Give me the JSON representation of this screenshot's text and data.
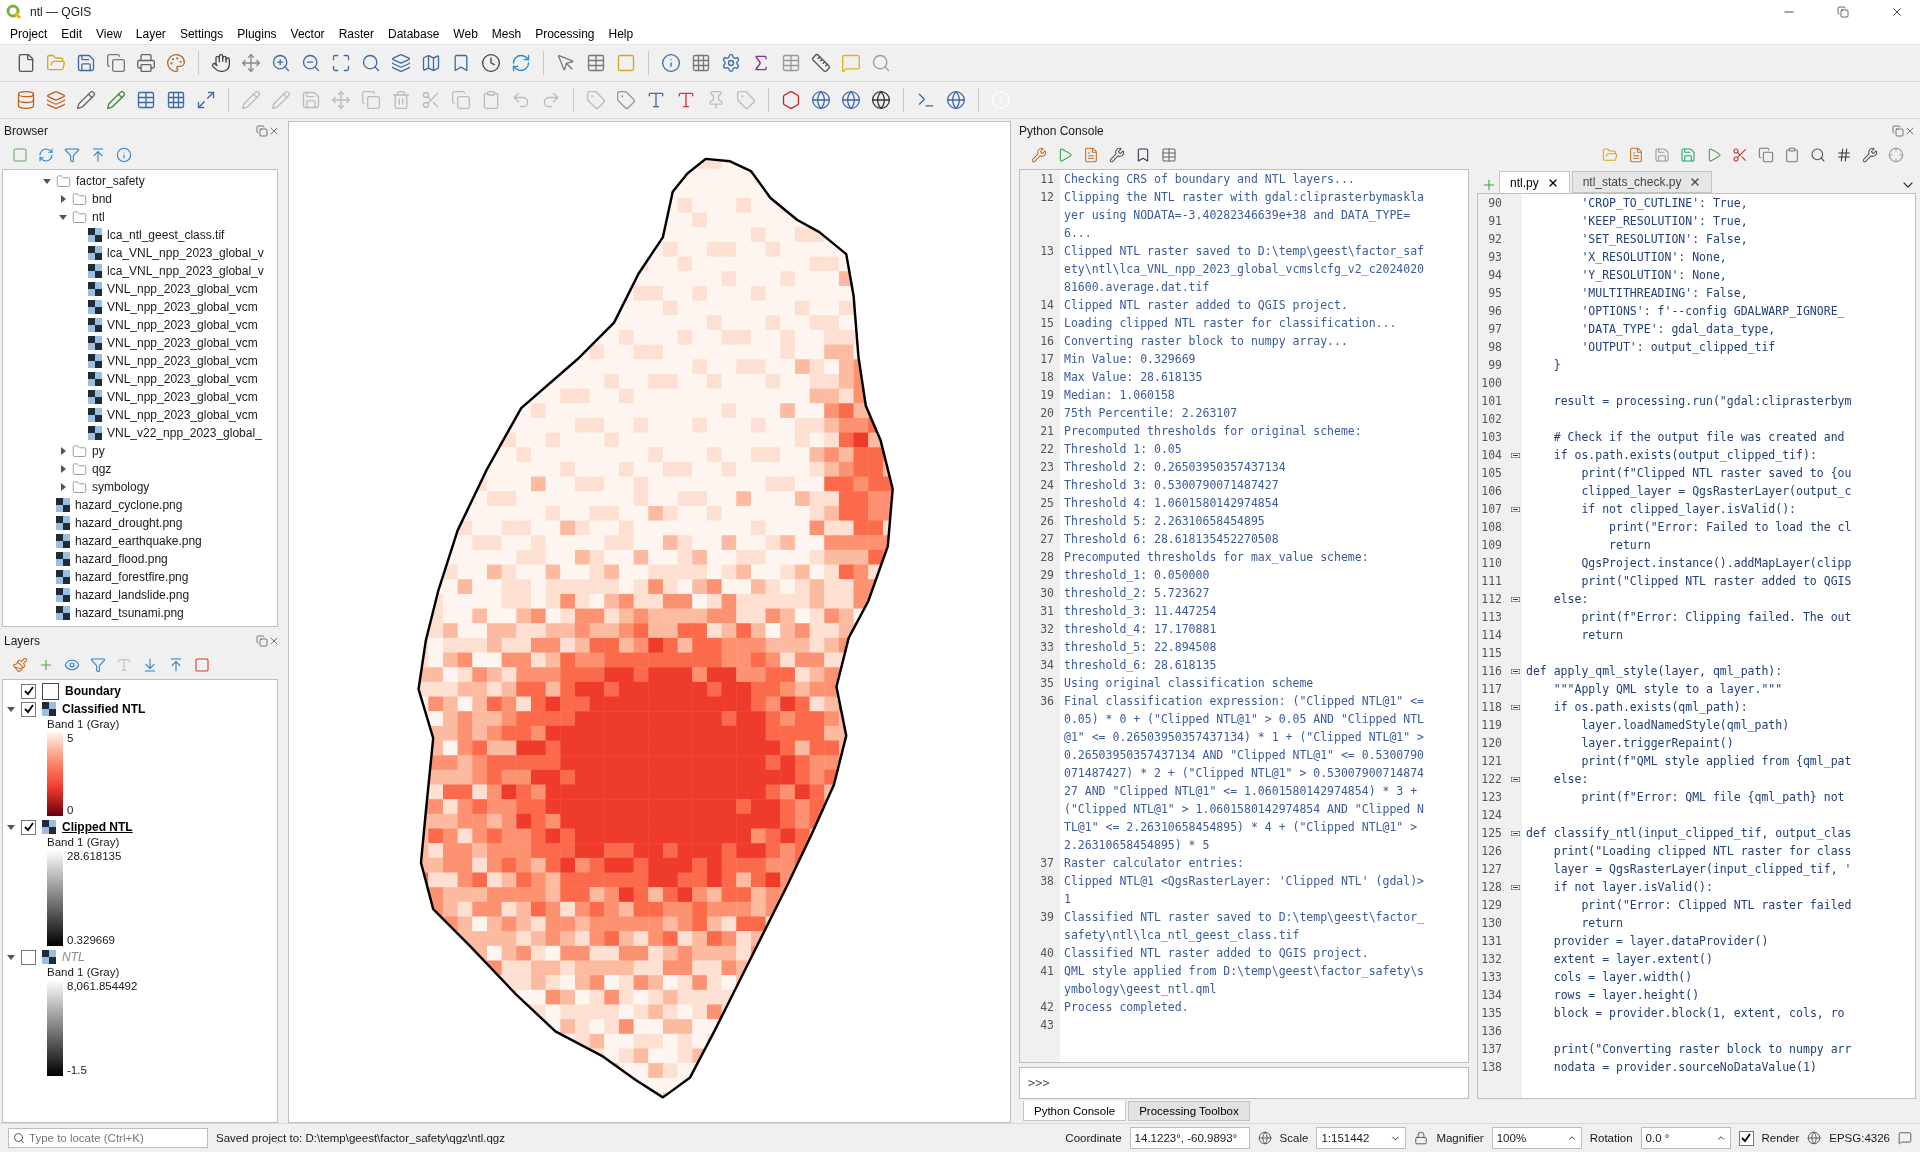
{
  "window": {
    "title": "ntl — QGIS"
  },
  "menu": [
    "Project",
    "Edit",
    "View",
    "Layer",
    "Settings",
    "Plugins",
    "Vector",
    "Raster",
    "Database",
    "Web",
    "Mesh",
    "Processing",
    "Help"
  ],
  "browser": {
    "title": "Browser",
    "items": [
      {
        "label": "factor_safety",
        "kind": "folder",
        "expanded": true,
        "children": [
          {
            "label": "bnd",
            "kind": "folder",
            "expanded": false
          },
          {
            "label": "ntl",
            "kind": "folder",
            "expanded": true,
            "children": [
              {
                "label": "lca_ntl_geest_class.tif",
                "kind": "raster"
              },
              {
                "label": "lca_VNL_npp_2023_global_v",
                "kind": "raster"
              },
              {
                "label": "lca_VNL_npp_2023_global_v",
                "kind": "raster"
              },
              {
                "label": "VNL_npp_2023_global_vcm",
                "kind": "raster"
              },
              {
                "label": "VNL_npp_2023_global_vcm",
                "kind": "raster"
              },
              {
                "label": "VNL_npp_2023_global_vcm",
                "kind": "raster"
              },
              {
                "label": "VNL_npp_2023_global_vcm",
                "kind": "raster"
              },
              {
                "label": "VNL_npp_2023_global_vcm",
                "kind": "raster"
              },
              {
                "label": "VNL_npp_2023_global_vcm",
                "kind": "raster"
              },
              {
                "label": "VNL_npp_2023_global_vcm",
                "kind": "raster"
              },
              {
                "label": "VNL_npp_2023_global_vcm",
                "kind": "raster"
              },
              {
                "label": "VNL_v22_npp_2023_global_",
                "kind": "raster"
              }
            ]
          },
          {
            "label": "py",
            "kind": "folder",
            "expanded": false
          },
          {
            "label": "qgz",
            "kind": "folder",
            "expanded": false
          },
          {
            "label": "symbology",
            "kind": "folder",
            "expanded": false
          }
        ]
      },
      {
        "label": "hazard_cyclone.png",
        "kind": "raster"
      },
      {
        "label": "hazard_drought.png",
        "kind": "raster"
      },
      {
        "label": "hazard_earthquake.png",
        "kind": "raster"
      },
      {
        "label": "hazard_flood.png",
        "kind": "raster"
      },
      {
        "label": "hazard_forestfire.png",
        "kind": "raster"
      },
      {
        "label": "hazard_landslide.png",
        "kind": "raster"
      },
      {
        "label": "hazard_tsunami.png",
        "kind": "raster"
      }
    ]
  },
  "layers": {
    "title": "Layers",
    "items": [
      {
        "name": "Boundary",
        "kind": "vector",
        "checked": true,
        "selected": false
      },
      {
        "name": "Classified NTL",
        "kind": "pseudocolor",
        "checked": true,
        "selected": false,
        "expanded": true,
        "band": "Band 1 (Gray)",
        "max": "5",
        "min": "0"
      },
      {
        "name": "Clipped NTL",
        "kind": "gray",
        "checked": true,
        "selected": true,
        "expanded": true,
        "band": "Band 1 (Gray)",
        "max": "28.618135",
        "min": "0.329669"
      },
      {
        "name": "NTL",
        "kind": "gray",
        "checked": false,
        "selected": false,
        "expanded": true,
        "band": "Band 1 (Gray)",
        "max": "8,061.854492",
        "min": "-1.5"
      }
    ]
  },
  "python_console": {
    "title": "Python Console",
    "output": [
      {
        "n": "11",
        "text": "Checking CRS of boundary and NTL layers..."
      },
      {
        "n": "12",
        "text": "Clipping the NTL raster with gdal:cliprasterbymasklayer using NODATA=-3.40282346639e+38 and DATA_TYPE=6..."
      },
      {
        "n": "13",
        "text": "Clipped NTL raster saved to D:\\temp\\geest\\factor_safety\\ntl\\lca_VNL_npp_2023_global_vcmslcfg_v2_c202402081600.average.dat.tif"
      },
      {
        "n": "14",
        "text": "Clipped NTL raster added to QGIS project."
      },
      {
        "n": "15",
        "text": "Loading clipped NTL raster for classification..."
      },
      {
        "n": "16",
        "text": "Converting raster block to numpy array..."
      },
      {
        "n": "17",
        "text": "Min Value: 0.329669"
      },
      {
        "n": "18",
        "text": "Max Value: 28.618135"
      },
      {
        "n": "19",
        "text": "Median: 1.060158"
      },
      {
        "n": "20",
        "text": "75th Percentile: 2.263107"
      },
      {
        "n": "21",
        "text": "Precomputed thresholds for original scheme:"
      },
      {
        "n": "22",
        "text": "Threshold 1: 0.05"
      },
      {
        "n": "23",
        "text": "Threshold 2: 0.26503950357437134"
      },
      {
        "n": "24",
        "text": "Threshold 3: 0.5300790071487427"
      },
      {
        "n": "25",
        "text": "Threshold 4: 1.0601580142974854"
      },
      {
        "n": "26",
        "text": "Threshold 5: 2.26310658454895"
      },
      {
        "n": "27",
        "text": "Threshold 6: 28.618135452270508"
      },
      {
        "n": "28",
        "text": "Precomputed thresholds for max_value scheme:"
      },
      {
        "n": "29",
        "text": "threshold_1: 0.050000"
      },
      {
        "n": "30",
        "text": "threshold_2: 5.723627"
      },
      {
        "n": "31",
        "text": "threshold_3: 11.447254"
      },
      {
        "n": "32",
        "text": "threshold_4: 17.170881"
      },
      {
        "n": "33",
        "text": "threshold_5: 22.894508"
      },
      {
        "n": "34",
        "text": "threshold_6: 28.618135"
      },
      {
        "n": "35",
        "text": "Using original classification scheme"
      },
      {
        "n": "36",
        "text": "Final classification expression: (\"Clipped NTL@1\" <= 0.05) * 0 + (\"Clipped NTL@1\" > 0.05 AND \"Clipped NTL@1\" <= 0.26503950357437134) * 1 + (\"Clipped NTL@1\" > 0.26503950357437134 AND \"Clipped NTL@1\" <= 0.5300790071487427) * 2 + (\"Clipped NTL@1\" > 0.5300790071487427 AND \"Clipped NTL@1\" <= 1.0601580142974854) * 3 + (\"Clipped NTL@1\" > 1.0601580142974854 AND \"Clipped NTL@1\" <= 2.26310658454895) * 4 + (\"Clipped NTL@1\" > 2.26310658454895) * 5"
      },
      {
        "n": "37",
        "text": "Raster calculator entries:"
      },
      {
        "n": "38",
        "text": "Clipped NTL@1 <QgsRasterLayer: 'Clipped NTL' (gdal)> 1"
      },
      {
        "n": "39",
        "text": "Classified NTL raster saved to D:\\temp\\geest\\factor_safety\\ntl\\lca_ntl_geest_class.tif"
      },
      {
        "n": "40",
        "text": "Classified NTL raster added to QGIS project."
      },
      {
        "n": "41",
        "text": "QML style applied from D:\\temp\\geest\\factor_safety\\symbology\\geest_ntl.qml"
      },
      {
        "n": "42",
        "text": "Process completed."
      },
      {
        "n": "43"
      }
    ],
    "prompt": ">>>",
    "editor_tabs": [
      {
        "label": "ntl.py",
        "selected": true
      },
      {
        "label": "ntl_stats_check.py",
        "selected": false
      }
    ],
    "code": [
      {
        "n": "90",
        "text": "        'CROP_TO_CUTLINE': True,",
        "fold": false
      },
      {
        "n": "91",
        "text": "        'KEEP_RESOLUTION': True,",
        "fold": false
      },
      {
        "n": "92",
        "text": "        'SET_RESOLUTION': False,",
        "fold": false
      },
      {
        "n": "93",
        "text": "        'X_RESOLUTION': None,",
        "fold": false
      },
      {
        "n": "94",
        "text": "        'Y_RESOLUTION': None,",
        "fold": false
      },
      {
        "n": "95",
        "text": "        'MULTITHREADING': False,",
        "fold": false
      },
      {
        "n": "96",
        "text": "        'OPTIONS': f'--config GDALWARP_IGNORE_",
        "fold": false
      },
      {
        "n": "97",
        "text": "        'DATA_TYPE': gdal_data_type,",
        "fold": false
      },
      {
        "n": "98",
        "text": "        'OUTPUT': output_clipped_tif",
        "fold": false
      },
      {
        "n": "99",
        "text": "    }",
        "fold": false
      },
      {
        "n": "100",
        "fold": false
      },
      {
        "n": "101",
        "text": "    result = processing.run(\"gdal:cliprasterbym",
        "fold": false
      },
      {
        "n": "102",
        "fold": false
      },
      {
        "n": "103",
        "text": "    # Check if the output file was created and",
        "fold": false
      },
      {
        "n": "104",
        "text": "    if os.path.exists(output_clipped_tif):",
        "fold": true
      },
      {
        "n": "105",
        "text": "        print(f\"Clipped NTL raster saved to {ou",
        "fold": false
      },
      {
        "n": "106",
        "text": "        clipped_layer = QgsRasterLayer(output_c",
        "fold": false
      },
      {
        "n": "107",
        "text": "        if not clipped_layer.isValid():",
        "fold": true
      },
      {
        "n": "108",
        "text": "            print(\"Error: Failed to load the cl",
        "fold": false
      },
      {
        "n": "109",
        "text": "            return",
        "fold": false
      },
      {
        "n": "110",
        "text": "        QgsProject.instance().addMapLayer(clipp",
        "fold": false
      },
      {
        "n": "111",
        "text": "        print(\"Clipped NTL raster added to QGIS",
        "fold": false
      },
      {
        "n": "112",
        "text": "    else:",
        "fold": true
      },
      {
        "n": "113",
        "text": "        print(f\"Error: Clipping failed. The out",
        "fold": false
      },
      {
        "n": "114",
        "text": "        return",
        "fold": false
      },
      {
        "n": "115",
        "fold": false
      },
      {
        "n": "116",
        "text": "def apply_qml_style(layer, qml_path):",
        "fold": true
      },
      {
        "n": "117",
        "text": "    \"\"\"Apply QML style to a layer.\"\"\"",
        "fold": false
      },
      {
        "n": "118",
        "text": "    if os.path.exists(qml_path):",
        "fold": true
      },
      {
        "n": "119",
        "text": "        layer.loadNamedStyle(qml_path)",
        "fold": false
      },
      {
        "n": "120",
        "text": "        layer.triggerRepaint()",
        "fold": false
      },
      {
        "n": "121",
        "text": "        print(f\"QML style applied from {qml_pat",
        "fold": false
      },
      {
        "n": "122",
        "text": "    else:",
        "fold": true
      },
      {
        "n": "123",
        "text": "        print(f\"Error: QML file {qml_path} not",
        "fold": false
      },
      {
        "n": "124",
        "fold": false
      },
      {
        "n": "125",
        "text": "def classify_ntl(input_clipped_tif, output_clas",
        "fold": true
      },
      {
        "n": "126",
        "text": "    print(\"Loading clipped NTL raster for class",
        "fold": false
      },
      {
        "n": "127",
        "text": "    layer = QgsRasterLayer(input_clipped_tif, '",
        "fold": false
      },
      {
        "n": "128",
        "text": "    if not layer.isValid():",
        "fold": true
      },
      {
        "n": "129",
        "text": "        print(\"Error: Clipped NTL raster failed",
        "fold": false
      },
      {
        "n": "130",
        "text": "        return",
        "fold": false
      },
      {
        "n": "131",
        "text": "    provider = layer.dataProvider()",
        "fold": false
      },
      {
        "n": "132",
        "text": "    extent = layer.extent()",
        "fold": false
      },
      {
        "n": "133",
        "text": "    cols = layer.width()",
        "fold": false
      },
      {
        "n": "134",
        "text": "    rows = layer.height()",
        "fold": false
      },
      {
        "n": "135",
        "text": "    block = provider.block(1, extent, cols, ro",
        "fold": false
      },
      {
        "n": "136",
        "fold": false
      },
      {
        "n": "137",
        "text": "    print(\"Converting raster block to numpy arr",
        "fold": false
      },
      {
        "n": "138",
        "text": "    nodata = provider.sourceNoDataValue(1)",
        "fold": false
      }
    ],
    "bottom_tabs": [
      {
        "label": "Python Console",
        "selected": true
      },
      {
        "label": "Processing Toolbox",
        "selected": false
      }
    ]
  },
  "status_bar": {
    "locate_placeholder": "Type to locate (Ctrl+K)",
    "message": "Saved project to: D:\\temp\\geest\\factor_safety\\qgz\\ntl.qgz",
    "coordinate_label": "Coordinate",
    "coordinate": "14.1223°, -60.9893°",
    "scale_label": "Scale",
    "scale": "1:151442",
    "magnifier_label": "Magnifier",
    "magnifier": "100%",
    "rotation_label": "Rotation",
    "rotation": "0.0 °",
    "render_label": "Render",
    "render": true,
    "crs": "EPSG:4326"
  }
}
